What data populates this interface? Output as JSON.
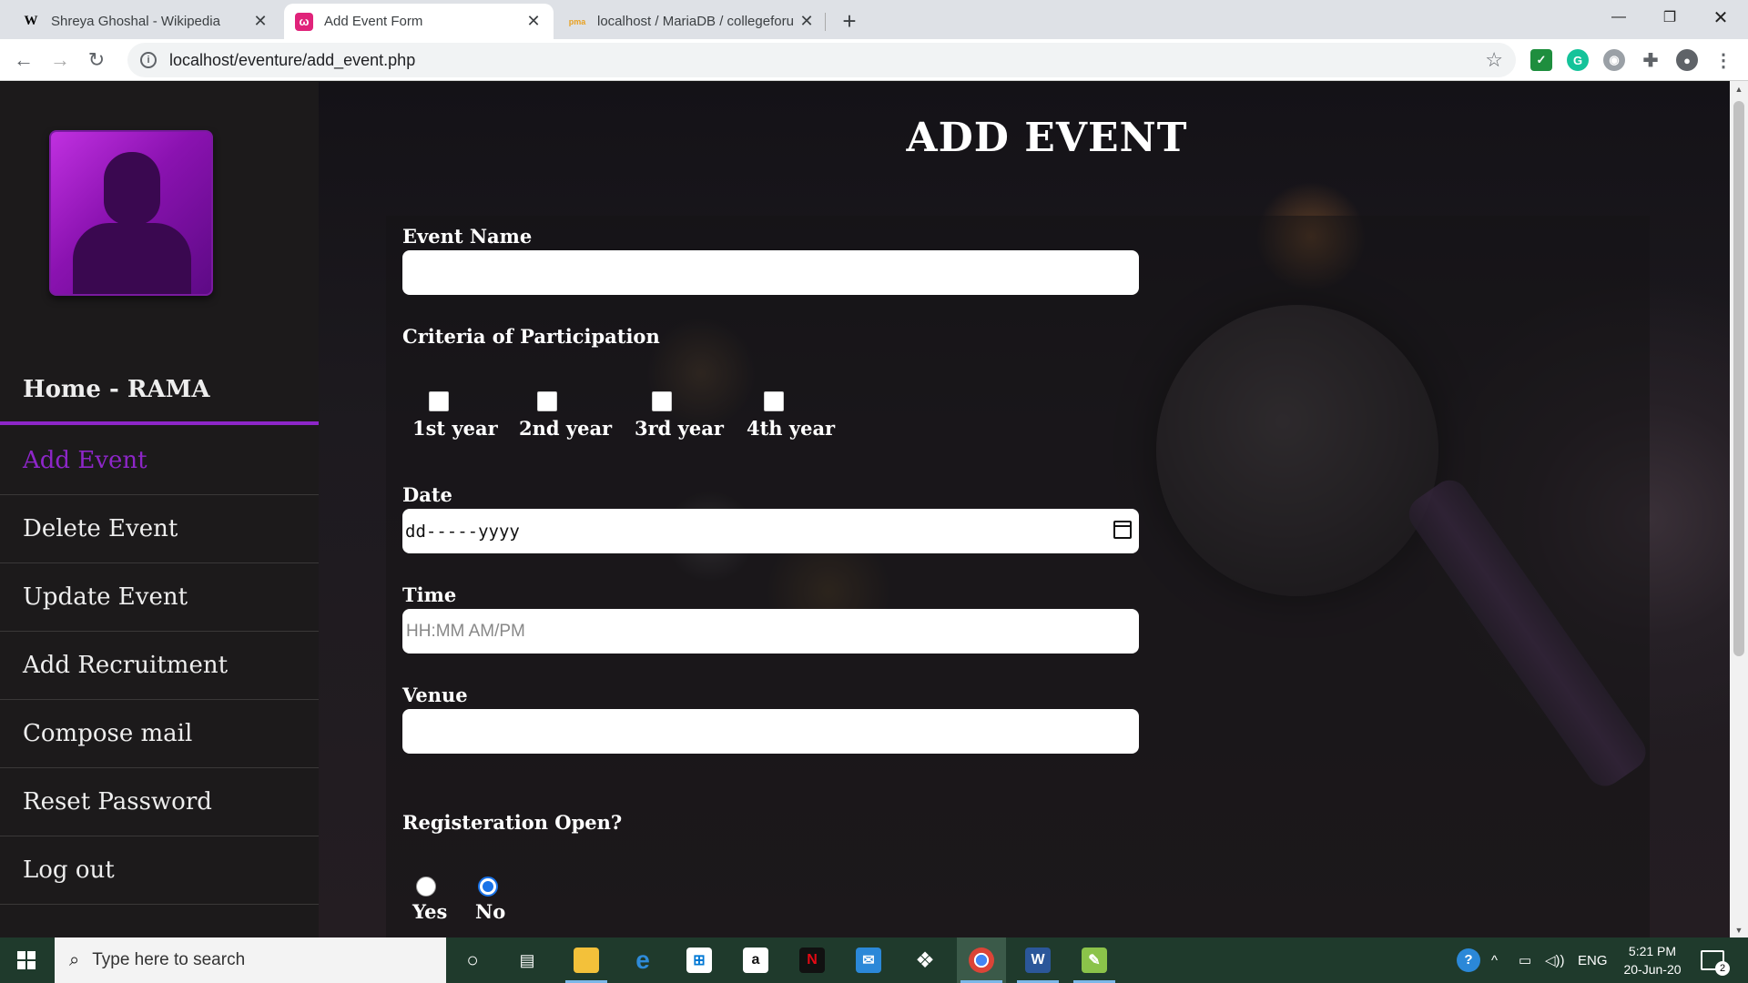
{
  "browser": {
    "tabs": [
      {
        "favicon": "W",
        "title": "Shreya Ghoshal - Wikipedia",
        "active": false
      },
      {
        "favicon": "ω",
        "title": "Add Event Form",
        "active": true
      },
      {
        "favicon": "pma",
        "title": "localhost / MariaDB / collegeforu",
        "active": false
      }
    ],
    "url": "localhost/eventure/add_event.php"
  },
  "sidebar": {
    "items": [
      {
        "label": "Home - RAMA"
      },
      {
        "label": "Add Event"
      },
      {
        "label": "Delete Event"
      },
      {
        "label": "Update Event"
      },
      {
        "label": "Add Recruitment"
      },
      {
        "label": "Compose mail"
      },
      {
        "label": "Reset Password"
      },
      {
        "label": "Log out"
      }
    ],
    "active_item": "Add Event"
  },
  "form": {
    "title": "ADD EVENT",
    "event_name": {
      "label": "Event Name",
      "value": ""
    },
    "criteria": {
      "label": "Criteria of Participation",
      "options": [
        "1st year",
        "2nd year",
        "3rd year",
        "4th year"
      ]
    },
    "date": {
      "label": "Date",
      "value": "dd-----yyyy"
    },
    "time": {
      "label": "Time",
      "placeholder": "HH:MM AM/PM"
    },
    "venue": {
      "label": "Venue",
      "value": ""
    },
    "registration": {
      "label": "Registeration Open?",
      "options": [
        "Yes",
        "No"
      ],
      "selected": "No"
    }
  },
  "taskbar": {
    "search_placeholder": "Type here to search",
    "language": "ENG",
    "time": "5:21 PM",
    "date": "20-Jun-20",
    "notification_count": "2"
  },
  "colors": {
    "accent": "#8d26c8",
    "sidebar_bg": "#1c1a1b",
    "radio_selected": "#1a73e8"
  }
}
